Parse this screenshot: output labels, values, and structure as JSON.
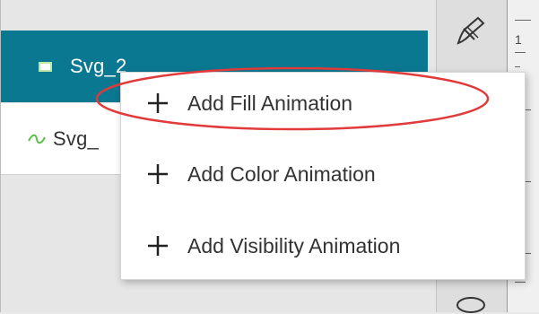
{
  "layers": [
    {
      "label": "Svg_2",
      "icon": "rectangle-layer-icon",
      "selected": true
    },
    {
      "label": "Svg_",
      "icon": "path-wave-icon",
      "selected": false
    }
  ],
  "ruler": {
    "number": "1"
  },
  "context_menu": {
    "items": [
      {
        "label": "Add Fill Animation",
        "icon": "plus-icon"
      },
      {
        "label": "Add Color Animation",
        "icon": "plus-icon"
      },
      {
        "label": "Add Visibility Animation",
        "icon": "plus-icon"
      }
    ]
  },
  "tools": {
    "top_icon": "pen-tool-icon",
    "bottom_icon": "ellipse-tool-icon"
  },
  "colors": {
    "selection": "#0a7891",
    "highlight_ring": "#e03a3a",
    "rect_icon_border": "#bfe8a4",
    "wave_icon": "#5bbf4a"
  }
}
